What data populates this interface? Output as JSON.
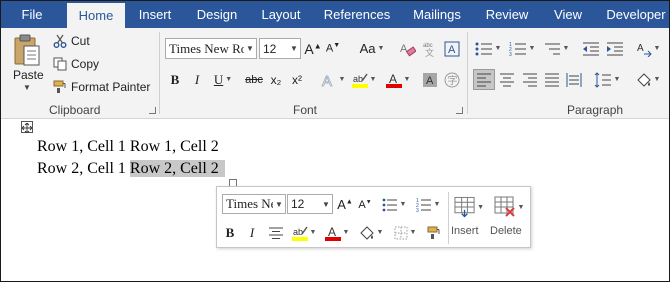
{
  "tabs": [
    "File",
    "Home",
    "Insert",
    "Design",
    "Layout",
    "References",
    "Mailings",
    "Review",
    "View",
    "Developer"
  ],
  "active_tab": "Home",
  "clipboard": {
    "paste_label": "Paste",
    "cut_label": "Cut",
    "copy_label": "Copy",
    "format_painter_label": "Format Painter",
    "group_label": "Clipboard"
  },
  "font": {
    "font_name": "Times New Ro",
    "font_size": "12",
    "change_case_label": "Aa",
    "bold_label": "B",
    "italic_label": "I",
    "underline_label": "U",
    "strike_label": "abc",
    "subscript_label": "x₂",
    "superscript_label": "x²",
    "group_label": "Font"
  },
  "paragraph": {
    "group_label": "Paragraph"
  },
  "document": {
    "rows": [
      [
        "Row 1, Cell 1",
        "Row 1, Cell 2"
      ],
      [
        "Row 2, Cell 1",
        "Row 2, Cell 2"
      ]
    ]
  },
  "mini_toolbar": {
    "font_name": "Times Ne",
    "font_size": "12",
    "bold_label": "B",
    "italic_label": "I",
    "insert_label": "Insert",
    "delete_label": "Delete"
  },
  "colors": {
    "tab_bar": "#2b579a",
    "ribbon": "#f3f3f3",
    "highlight_yellow": "#ffff00",
    "font_red": "#e00000",
    "selection": "#c8c8c8"
  }
}
